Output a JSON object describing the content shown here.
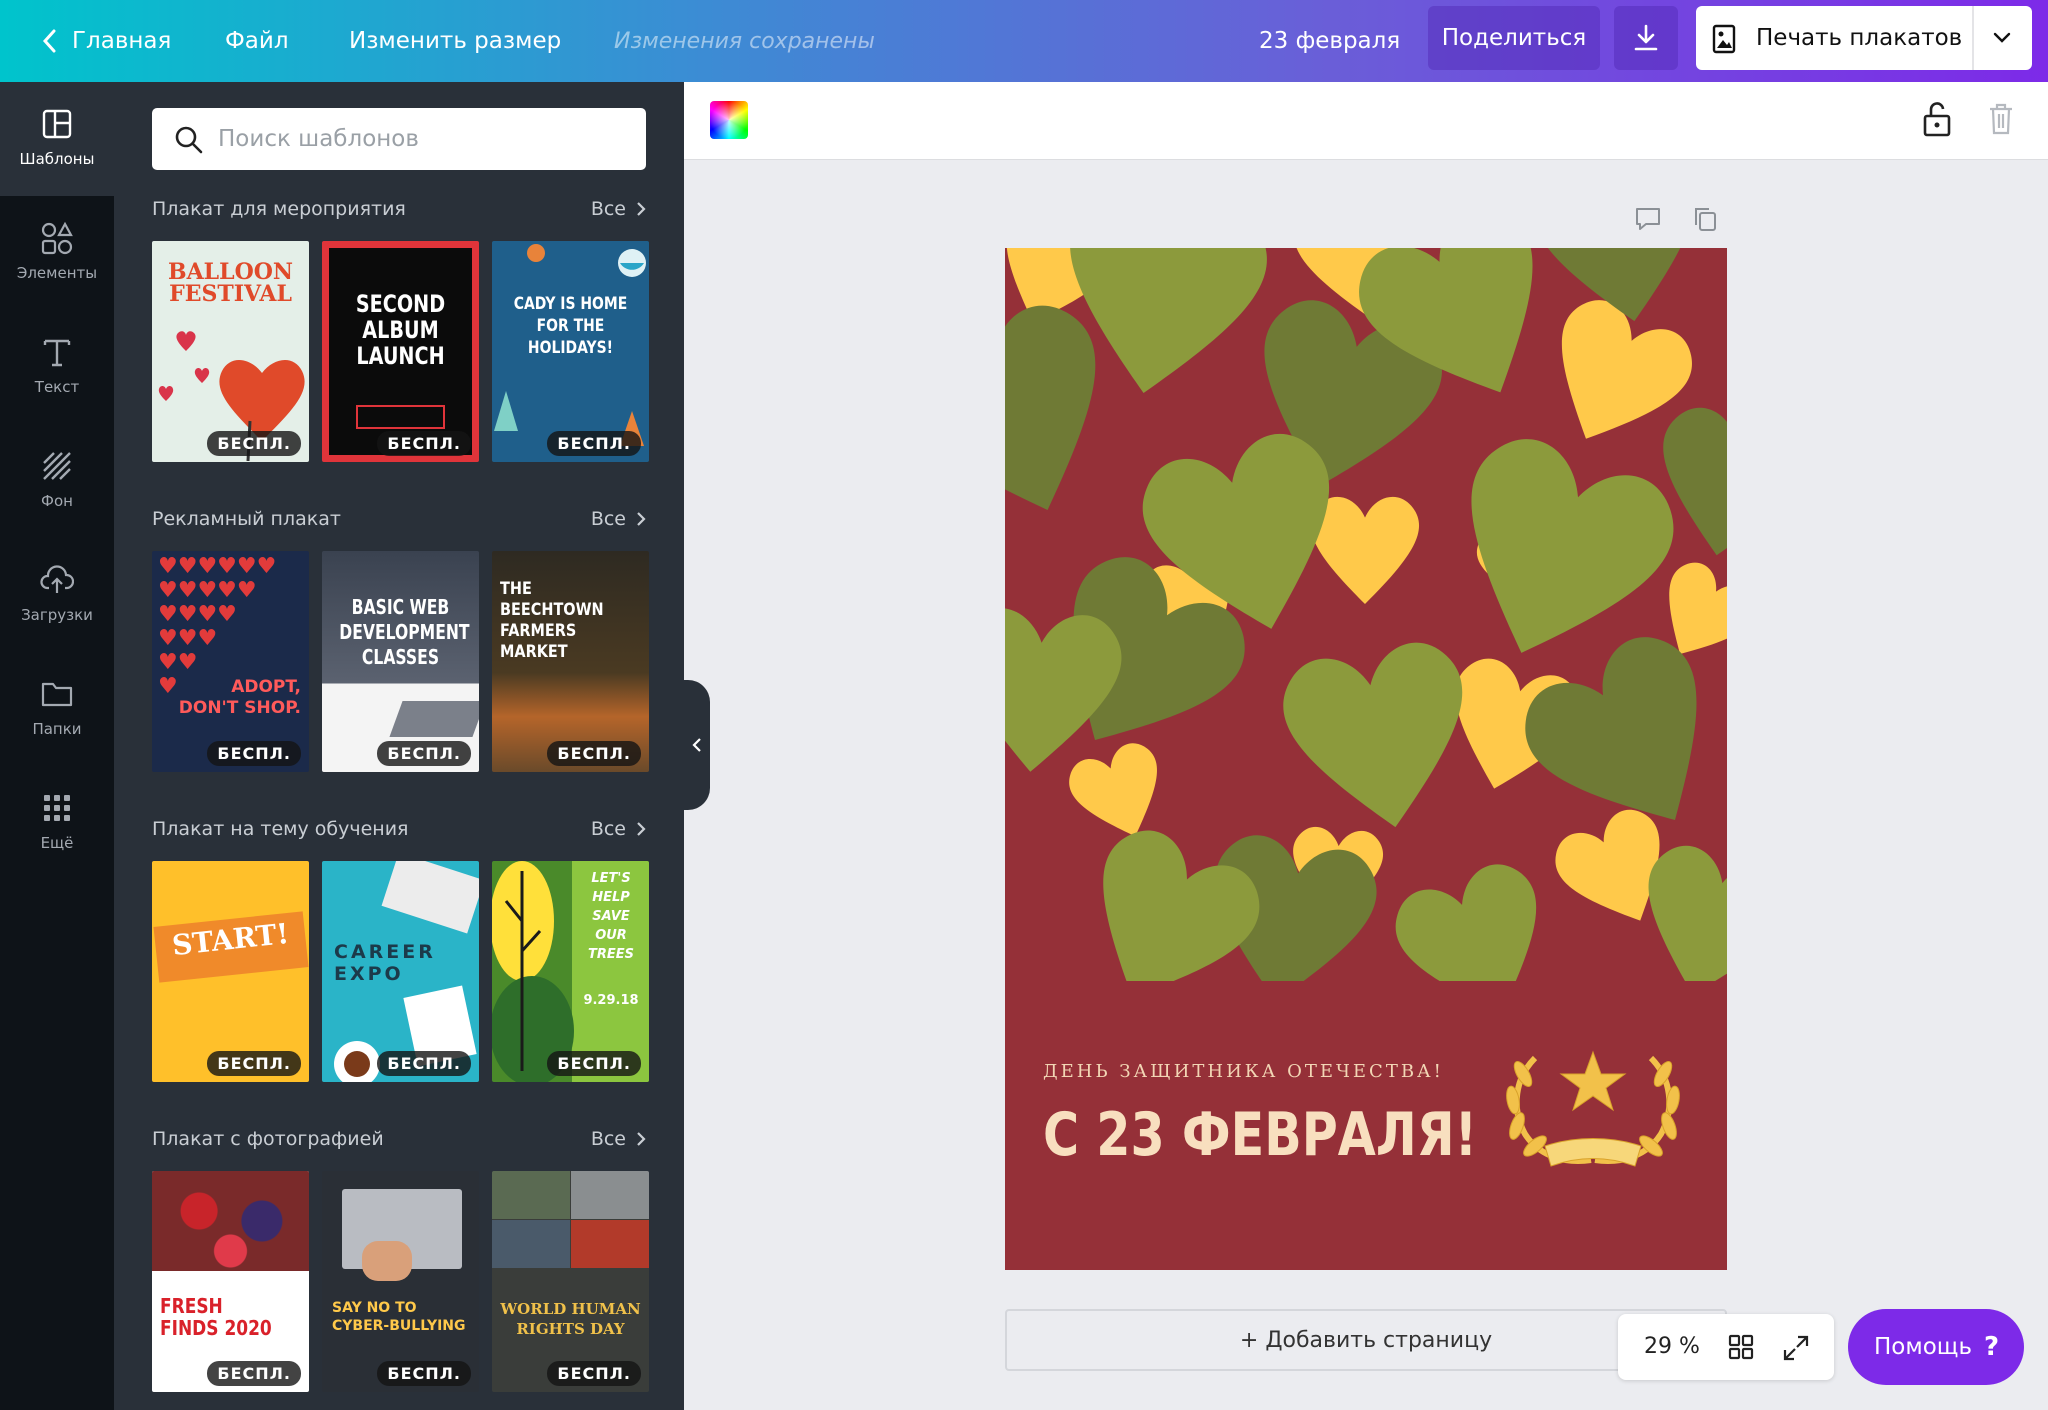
{
  "topbar": {
    "home": "Главная",
    "file": "Файл",
    "resize": "Изменить размер",
    "saved_status": "Изменения сохранены",
    "doc_title": "23 февраля",
    "share": "Поделиться",
    "print": "Печать плакатов"
  },
  "rail": {
    "items": [
      {
        "label": "Шаблоны",
        "icon": "templates-icon"
      },
      {
        "label": "Элементы",
        "icon": "elements-icon"
      },
      {
        "label": "Текст",
        "icon": "text-icon"
      },
      {
        "label": "Фон",
        "icon": "background-icon"
      },
      {
        "label": "Загрузки",
        "icon": "upload-icon"
      },
      {
        "label": "Папки",
        "icon": "folder-icon"
      },
      {
        "label": "Ещё",
        "icon": "more-icon"
      }
    ]
  },
  "panel": {
    "search_placeholder": "Поиск шаблонов",
    "all_label": "Все",
    "free_badge": "БЕСПЛ.",
    "sections": [
      {
        "title": "Плакат для мероприятия",
        "thumbs": [
          {
            "name": "BALLOON FESTIVAL"
          },
          {
            "name": "SECOND ALBUM LAUNCH"
          },
          {
            "name": "CADY IS HOME FOR THE HOLIDAYS!"
          }
        ]
      },
      {
        "title": "Рекламный плакат",
        "thumbs": [
          {
            "name": "ADOPT, DON'T SHOP."
          },
          {
            "name": "BASIC WEB DEVELOPMENT CLASSES"
          },
          {
            "name": "THE BEECHTOWN FARMERS MARKET"
          }
        ]
      },
      {
        "title": "Плакат на тему обучения",
        "thumbs": [
          {
            "name": "START!"
          },
          {
            "name": "CAREER EXPO"
          },
          {
            "name": "LET'S HELP SAVE OUR TREES"
          }
        ]
      },
      {
        "title": "Плакат с фотографией",
        "thumbs": [
          {
            "name": "FRESH FINDS 2020"
          },
          {
            "name": "SAY NO TO CYBER-BULLYING"
          },
          {
            "name": "WORLD HUMAN RIGHTS DAY"
          }
        ]
      }
    ]
  },
  "thumb_text": {
    "t1a": "BALLOON",
    "t1b": "FESTIVAL",
    "t2a": "SECOND",
    "t2b": "ALBUM",
    "t2c": "LAUNCH",
    "t3a": "CADY IS HOME",
    "t3b": "FOR THE",
    "t3c": "HOLIDAYS!",
    "t4a": "ADOPT,",
    "t4b": "DON'T SHOP.",
    "t5a": "BASIC WEB",
    "t5b": "DEVELOPMENT",
    "t5c": "CLASSES",
    "t6a": "THE BEECHTOWN",
    "t6b": "FARMERS",
    "t6c": "MARKET",
    "t7a": "START!",
    "t8a": "CAREER",
    "t8b": "EXPO",
    "t9a": "LET'S",
    "t9b": "HELP",
    "t9c": "SAVE",
    "t9d": "OUR",
    "t9e": "TREES",
    "t9f": "9.29.18",
    "t10a": "FRESH",
    "t10b": "FINDS 2020",
    "t11a": "SAY NO TO",
    "t11b": "CYBER-BULLYING",
    "t12a": "WORLD HUMAN",
    "t12b": "RIGHTS DAY"
  },
  "poster": {
    "subtitle": "ДЕНЬ ЗАЩИТНИКА ОТЕЧЕСТВА!",
    "title": "С 23 ФЕВРАЛЯ!",
    "colors": {
      "bg": "#953038",
      "heart_olive": "#8c9a3c",
      "heart_dark": "#6f7a35",
      "heart_yellow": "#ffc94a",
      "text": "#f8dfbf"
    }
  },
  "canvas": {
    "add_page": "+ Добавить страницу",
    "zoom": "29 %",
    "help": "Помощь",
    "help_q": "?"
  }
}
